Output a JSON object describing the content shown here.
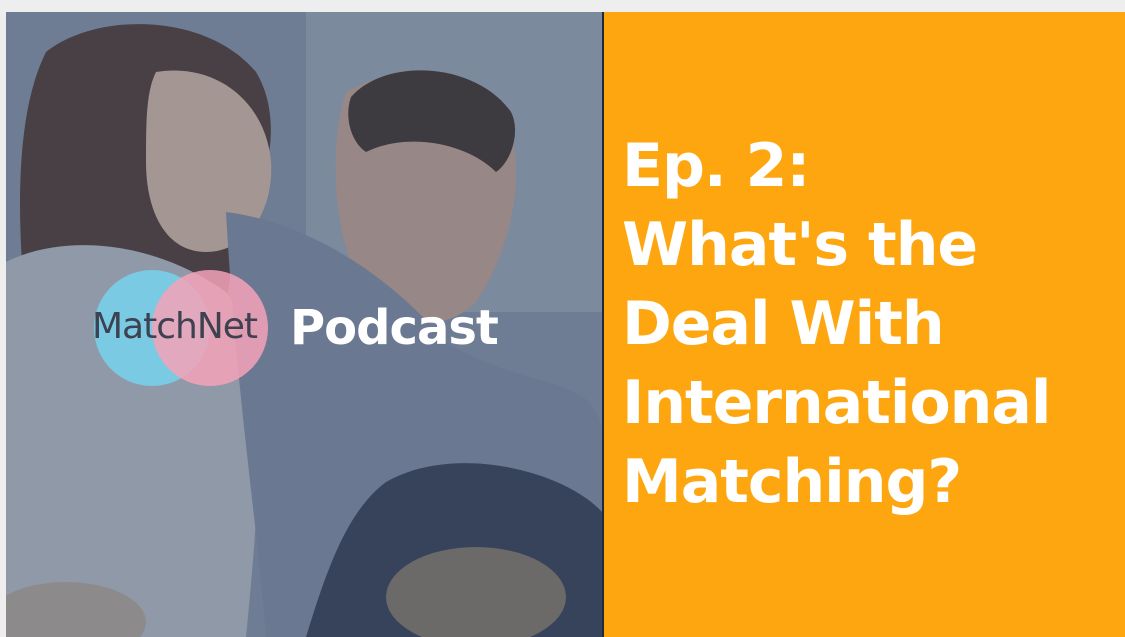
{
  "logo": {
    "brand_text": "MatchNet",
    "tagline": "Podcast"
  },
  "episode": {
    "title_lines": [
      "Ep. 2:",
      "What's the",
      "Deal With",
      "International",
      "Matching?"
    ]
  },
  "colors": {
    "accent_orange": "#fda60f",
    "logo_blue": "#78cee8",
    "logo_pink": "#f4a2b7",
    "divider": "#1f2a3a"
  }
}
